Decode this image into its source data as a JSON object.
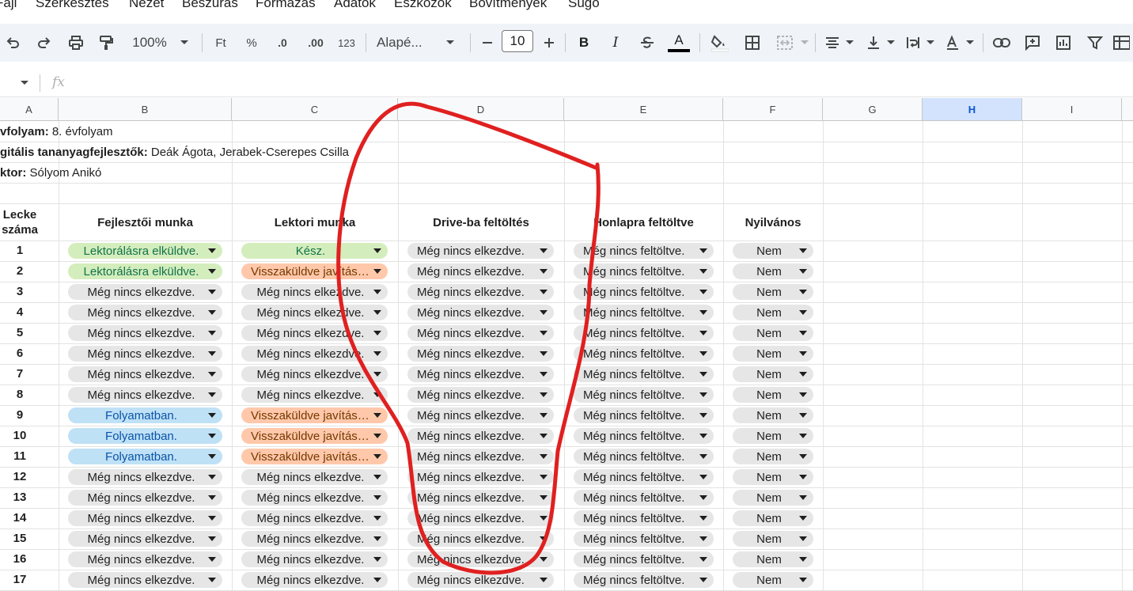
{
  "menu": [
    "Fájl",
    "Szerkesztés",
    "Nézet",
    "Beszúrás",
    "Formázás",
    "Adatok",
    "Eszközök",
    "Bővítmények",
    "Súgó"
  ],
  "toolbar": {
    "zoom": "100%",
    "currency": "Ft",
    "percent": "%",
    "dec_decrease": ".0",
    "dec_increase": ".00",
    "number_format": "123",
    "font": "Alapé...",
    "font_size": "10",
    "bold": "B",
    "italic": "I",
    "text_color": "A"
  },
  "formula_bar": {
    "fx": "fx"
  },
  "columns": [
    "A",
    "B",
    "C",
    "D",
    "E",
    "F",
    "G",
    "H",
    "I"
  ],
  "selected_column": "H",
  "info": {
    "grade_label": "vfolyam:",
    "grade_value": " 8. évfolyam",
    "devs_label": "gitális tananyagfejlesztők:",
    "devs_value": " Deák Ágota, Jerabek-Cserepes Csilla",
    "lector_label": "ktor:",
    "lector_value": " Sólyom Anikó"
  },
  "headers": {
    "lesson_line1": "Lecke",
    "lesson_line2": "száma",
    "dev_work": "Fejlesztői munka",
    "lector_work": "Lektori munka",
    "drive": "Drive-ba feltöltés",
    "homepage": "Honlapra feltöltve",
    "public": "Nyilvános"
  },
  "rows": [
    {
      "n": "1",
      "b": "Lektorálásra elküldve.",
      "c": "Kész.",
      "d": "Még nincs elkezdve.",
      "e": "Még nincs feltöltve.",
      "f": "Nem"
    },
    {
      "n": "2",
      "b": "Lektorálásra elküldve.",
      "c": "Visszaküldve javításra.",
      "d": "Még nincs elkezdve.",
      "e": "Még nincs feltöltve.",
      "f": "Nem"
    },
    {
      "n": "3",
      "b": "Még nincs elkezdve.",
      "c": "Még nincs elkezdve.",
      "d": "Még nincs elkezdve.",
      "e": "Még nincs feltöltve.",
      "f": "Nem"
    },
    {
      "n": "4",
      "b": "Még nincs elkezdve.",
      "c": "Még nincs elkezdve.",
      "d": "Még nincs elkezdve.",
      "e": "Még nincs feltöltve.",
      "f": "Nem"
    },
    {
      "n": "5",
      "b": "Még nincs elkezdve.",
      "c": "Még nincs elkezdve.",
      "d": "Még nincs elkezdve.",
      "e": "Még nincs feltöltve.",
      "f": "Nem"
    },
    {
      "n": "6",
      "b": "Még nincs elkezdve.",
      "c": "Még nincs elkezdve.",
      "d": "Még nincs elkezdve.",
      "e": "Még nincs feltöltve.",
      "f": "Nem"
    },
    {
      "n": "7",
      "b": "Még nincs elkezdve.",
      "c": "Még nincs elkezdve.",
      "d": "Még nincs elkezdve.",
      "e": "Még nincs feltöltve.",
      "f": "Nem"
    },
    {
      "n": "8",
      "b": "Még nincs elkezdve.",
      "c": "Még nincs elkezdve.",
      "d": "Még nincs elkezdve.",
      "e": "Még nincs feltöltve.",
      "f": "Nem"
    },
    {
      "n": "9",
      "b": "Folyamatban.",
      "c": "Visszaküldve javításra.",
      "d": "Még nincs elkezdve.",
      "e": "Még nincs feltöltve.",
      "f": "Nem"
    },
    {
      "n": "10",
      "b": "Folyamatban.",
      "c": "Visszaküldve javításra.",
      "d": "Még nincs elkezdve.",
      "e": "Még nincs feltöltve.",
      "f": "Nem"
    },
    {
      "n": "11",
      "b": "Folyamatban.",
      "c": "Visszaküldve javításra.",
      "d": "Még nincs elkezdve.",
      "e": "Még nincs feltöltve.",
      "f": "Nem"
    },
    {
      "n": "12",
      "b": "Még nincs elkezdve.",
      "c": "Még nincs elkezdve.",
      "d": "Még nincs elkezdve.",
      "e": "Még nincs feltöltve.",
      "f": "Nem"
    },
    {
      "n": "13",
      "b": "Még nincs elkezdve.",
      "c": "Még nincs elkezdve.",
      "d": "Még nincs elkezdve.",
      "e": "Még nincs feltöltve.",
      "f": "Nem"
    },
    {
      "n": "14",
      "b": "Még nincs elkezdve.",
      "c": "Még nincs elkezdve.",
      "d": "Még nincs elkezdve.",
      "e": "Még nincs feltöltve.",
      "f": "Nem"
    },
    {
      "n": "15",
      "b": "Még nincs elkezdve.",
      "c": "Még nincs elkezdve.",
      "d": "Még nincs elkezdve.",
      "e": "Még nincs feltöltve.",
      "f": "Nem"
    },
    {
      "n": "16",
      "b": "Még nincs elkezdve.",
      "c": "Még nincs elkezdve.",
      "d": "Még nincs elkezdve.",
      "e": "Még nincs feltöltve.",
      "f": "Nem"
    },
    {
      "n": "17",
      "b": "Még nincs elkezdve.",
      "c": "Még nincs elkezdve.",
      "d": "Még nincs elkezdve.",
      "e": "Még nincs feltöltve.",
      "f": "Nem"
    }
  ],
  "status_colors": {
    "Lektorálásra elküldve.": {
      "bg": "#d4edbc",
      "fg": "#11734b"
    },
    "Kész.": {
      "bg": "#d4edbc",
      "fg": "#11734b"
    },
    "Visszaküldve javításra.": {
      "bg": "#ffc8aa",
      "fg": "#753800"
    },
    "Folyamatban.": {
      "bg": "#bfe1f6",
      "fg": "#0a53a8"
    },
    "default": {
      "bg": "#e6e6e6",
      "fg": "#1f1f1f"
    }
  },
  "annotation_color": "#e02020"
}
